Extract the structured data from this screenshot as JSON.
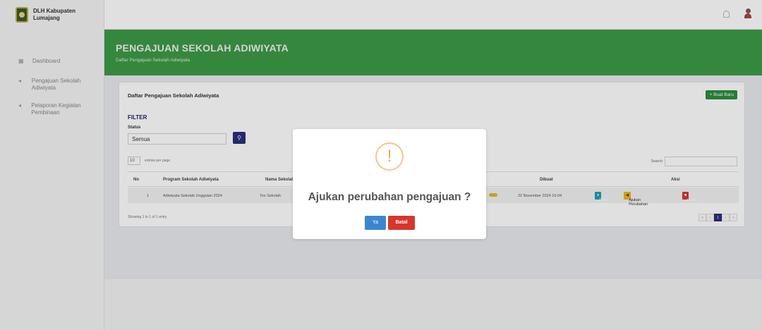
{
  "brand": {
    "name": "DLH Kabupaten Lumajang"
  },
  "sidebar": {
    "items": [
      {
        "label": "Dashboard",
        "icon": "dashboard-icon"
      },
      {
        "label": "Pengajuan Sekolah Adiwiyata",
        "icon": "arrow-icon"
      },
      {
        "label": "Pelaporan Kegiatan Pembinaan",
        "icon": "arrow-icon"
      }
    ]
  },
  "header": {
    "title": "PENGAJUAN SEKOLAH ADIWIYATA",
    "subtitle": "Daftar Pengajuan Sekolah Adiwiyata"
  },
  "card": {
    "title": "Daftar Pengajuan Sekolah Adiwiyata",
    "add_button": "+ Buat Baru",
    "filter_label": "FILTER",
    "status_label": "Status",
    "status_value": "Semua",
    "length_value": "10",
    "length_label": "entries per page",
    "search_label": "Search:"
  },
  "table": {
    "headers": [
      "No",
      "Program Sekolah Adiwiyata",
      "Nama Sekolah",
      "Dibuat",
      "Aksi"
    ],
    "rows": [
      {
        "no": "1",
        "program": "Adiwiyata Sekolah Unggulan 2024",
        "nama": "Tes Sekolah",
        "dibuat": "22 November 2024 16:04"
      }
    ],
    "actions": {
      "detail": "Detail",
      "ajukan": "Ajukan Perubahan",
      "hapus": "Hapus"
    },
    "info": "Showing 1 to 1 of 1 entry",
    "pager": [
      "«",
      "‹",
      "1",
      "›",
      "»"
    ]
  },
  "modal": {
    "icon": "!",
    "message": "Ajukan perubahan pengajuan ?",
    "confirm": "Ya",
    "cancel": "Batal"
  },
  "colors": {
    "header_green": "#3e9a47",
    "primary_navy": "#2a2f7a",
    "confirm_blue": "#3b87cf",
    "cancel_red": "#d7362c",
    "warn_orange": "#f5a352"
  }
}
